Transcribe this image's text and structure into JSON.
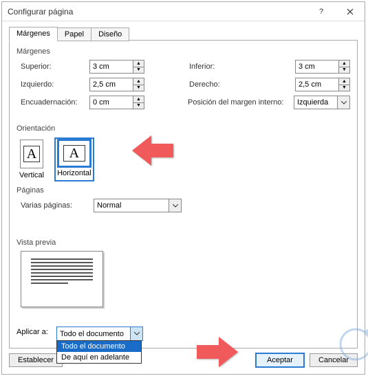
{
  "title": "Configurar página",
  "tabs": {
    "margins": "Márgenes",
    "paper": "Papel",
    "design": "Diseño"
  },
  "margins": {
    "group": "Márgenes",
    "top_label": "Superior:",
    "top_value": "3 cm",
    "bottom_label": "Inferior:",
    "bottom_value": "3 cm",
    "left_label": "Izquierdo:",
    "left_value": "2,5 cm",
    "right_label": "Derecho:",
    "right_value": "2,5 cm",
    "gutter_label": "Encuadernación:",
    "gutter_value": "0 cm",
    "gutter_pos_label": "Posición del margen interno:",
    "gutter_pos_value": "Izquierda"
  },
  "orientation": {
    "group": "Orientación",
    "vertical": "Vertical",
    "horizontal": "Horizontal"
  },
  "pages": {
    "group": "Páginas",
    "multi_label": "Varias páginas:",
    "multi_value": "Normal"
  },
  "preview": {
    "group": "Vista previa"
  },
  "apply": {
    "label": "Aplicar a:",
    "value": "Todo el documento",
    "options": {
      "all": "Todo el documento",
      "fwd": "De aquí en adelante"
    }
  },
  "buttons": {
    "set_default": "Establecer",
    "ok": "Aceptar",
    "cancel": "Cancelar"
  },
  "colors": {
    "accent": "#2a7bd1",
    "arrow": "#f15a5a"
  }
}
